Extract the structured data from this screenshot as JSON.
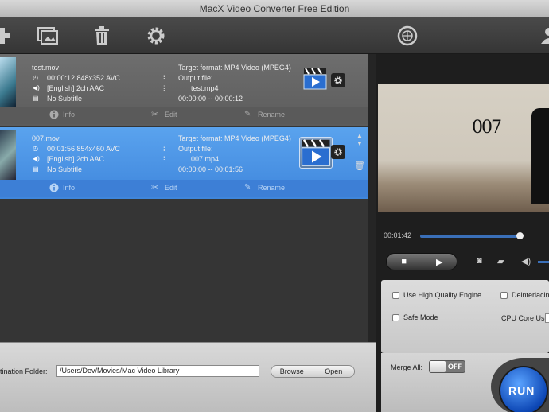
{
  "window": {
    "title": "MacX Video Converter Free Edition"
  },
  "toolbar": {
    "buttons": [
      "add-video",
      "add-photo",
      "delete",
      "settings",
      "update"
    ]
  },
  "files": [
    {
      "name": "test.mov",
      "duration_res_codec": "00:00:12 848x352 AVC",
      "audio": "[English] 2ch AAC",
      "subtitle": "No Subtitle",
      "target_format": "Target format: MP4 Video (MPEG4)",
      "output_label": "Output file:",
      "output_file": "test.mp4",
      "range": "00:00:00 -- 00:00:12",
      "selected": false
    },
    {
      "name": "007.mov",
      "duration_res_codec": "00:01:56 854x460 AVC",
      "audio": "[English] 2ch AAC",
      "subtitle": "No Subtitle",
      "target_format": "Target format: MP4 Video (MPEG4)",
      "output_label": "Output file:",
      "output_file": "007.mp4",
      "range": "00:00:00 -- 00:01:56",
      "selected": true
    }
  ],
  "actions": {
    "info": "Info",
    "edit": "Edit",
    "rename": "Rename"
  },
  "destination": {
    "label": "tination Folder:",
    "path": "/Users/Dev/Movies/Mac Video Library",
    "browse": "Browse",
    "open": "Open"
  },
  "player": {
    "time": "00:01:42",
    "progress": 0.94,
    "overlay_text": "007"
  },
  "options": {
    "high_quality": "Use High Quality Engine",
    "deinterlace": "Deinterlacin",
    "safe_mode": "Safe Mode",
    "cpu_core": "CPU Core Use:"
  },
  "merge": {
    "label": "Merge All:",
    "state": "OFF"
  },
  "run": {
    "label": "RUN"
  },
  "colors": {
    "selection": "#4a90e2",
    "accent": "#3a6fb8",
    "run": "#0d47b5"
  }
}
